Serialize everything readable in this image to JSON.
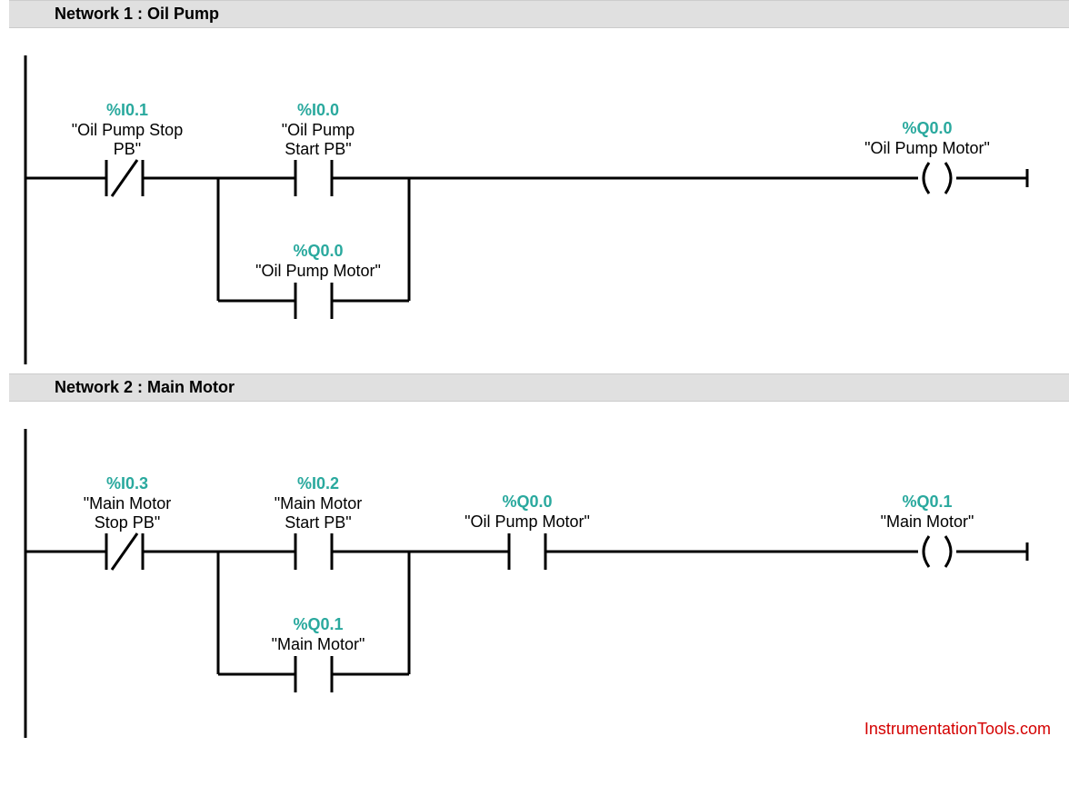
{
  "networks": [
    {
      "title": "Network 1 : Oil Pump",
      "elements": {
        "e1_addr": "%I0.1",
        "e1_lbl": "\"Oil Pump Stop\nPB\"",
        "e2_addr": "%I0.0",
        "e2_lbl": "\"Oil Pump\nStart PB\"",
        "e3_addr": "%Q0.0",
        "e3_lbl": "\"Oil Pump Motor\"",
        "seal_addr": "%Q0.0",
        "seal_lbl": "\"Oil Pump Motor\""
      }
    },
    {
      "title": "Network 2 : Main Motor",
      "elements": {
        "e1_addr": "%I0.3",
        "e1_lbl": "\"Main Motor\nStop PB\"",
        "e2_addr": "%I0.2",
        "e2_lbl": "\"Main Motor\nStart PB\"",
        "e3_addr": "%Q0.0",
        "e3_lbl": "\"Oil Pump Motor\"",
        "e4_addr": "%Q0.1",
        "e4_lbl": "\"Main Motor\"",
        "seal_addr": "%Q0.1",
        "seal_lbl": "\"Main Motor\""
      }
    }
  ],
  "footer": "InstrumentationTools.com"
}
